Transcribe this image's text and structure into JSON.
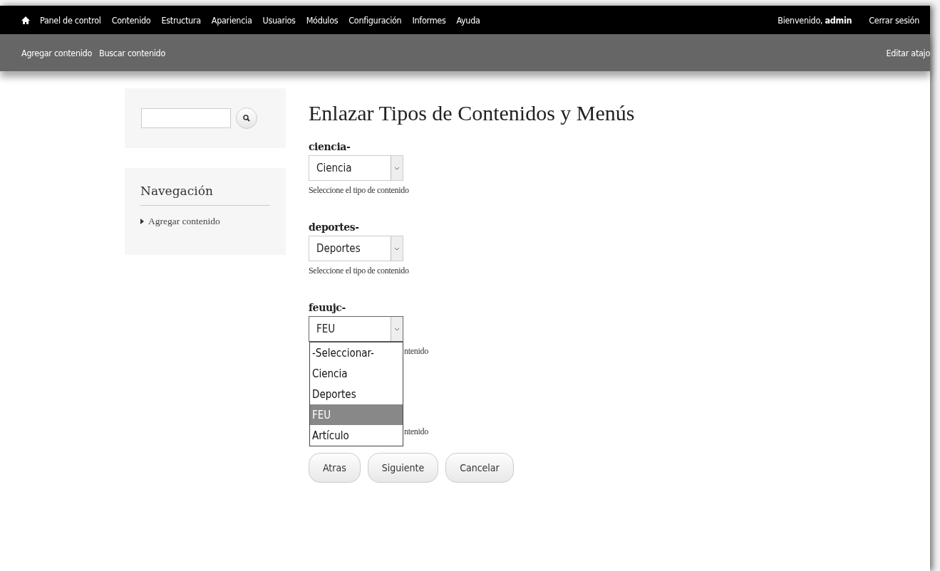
{
  "toolbar": {
    "menu": [
      "Panel de control",
      "Contenido",
      "Estructura",
      "Apariencia",
      "Usuarios",
      "Módulos",
      "Configuración",
      "Informes",
      "Ayuda"
    ],
    "welcome": "Bienvenido, **admin**",
    "logout": "Cerrar sesión"
  },
  "shortcuts": {
    "items": [
      "Agregar contenido",
      "Buscar contenido"
    ],
    "edit": "Editar atajo"
  },
  "sidebar": {
    "navigation": {
      "title": "Navegación",
      "items": [
        "Agregar contenido"
      ]
    }
  },
  "page": {
    "title": "Enlazar Tipos de Contenidos y Menús",
    "fields": [
      {
        "label": "ciencia-",
        "value": "Ciencia",
        "description": "Seleccione el tipo de contenido"
      },
      {
        "label": "deportes-",
        "value": "Deportes",
        "description": "Seleccione el tipo de contenido"
      },
      {
        "label": "feuujc-",
        "value": "FEU",
        "description": "ntenido",
        "covered": true,
        "expanded": true,
        "options": [
          {
            "label": "-Seleccionar-",
            "selected": false
          },
          {
            "label": "Ciencia",
            "selected": false
          },
          {
            "label": "Deportes",
            "selected": false
          },
          {
            "label": "FEU",
            "selected": true
          },
          {
            "label": "Artículo",
            "selected": false
          }
        ]
      },
      {
        "description": "ntenido",
        "covered": true
      }
    ],
    "buttons": [
      "Atras",
      "Siguiente",
      "Cancelar"
    ]
  }
}
